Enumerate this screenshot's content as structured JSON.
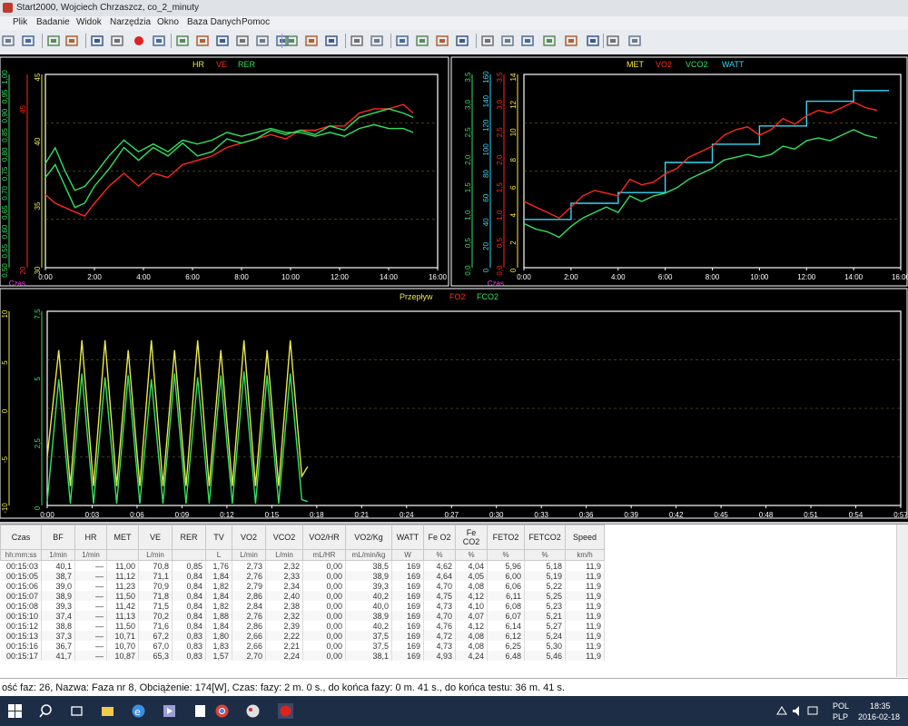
{
  "window": {
    "title": "Start2000,  Wojciech Chrzaszcz,  co_2_minuty"
  },
  "menu": [
    "Plik",
    "Badanie",
    "Widok",
    "Narzędzia",
    "Okno",
    "Baza Danych",
    "Pomoc"
  ],
  "toolbar_icons": [
    "open-icon",
    "save-icon",
    "print-icon",
    "preview-icon",
    "arrow-right-icon",
    "link-icon",
    "record-icon",
    "forward-icon",
    "pen-icon",
    "bar-icon",
    "arrow-into-icon",
    "export-icon",
    "select-icon",
    "check-icon",
    "tools-icon",
    "settings-icon",
    "cancel-icon",
    "flag-icon",
    "key-icon",
    "info-icon",
    "zoom-in-icon",
    "zoom-out-icon",
    "zoom-fit-icon",
    "zoom-reset-icon",
    "chart1-icon",
    "chart2-icon",
    "chart3-icon",
    "chart4-icon",
    "table-icon",
    "grid-icon",
    "co-icon"
  ],
  "colors": {
    "hr": "#e8e84a",
    "ve": "#ff2a1a",
    "rer": "#33e060",
    "met": "#ffe840",
    "vo2": "#ff2a1a",
    "vco2": "#33e060",
    "watt": "#35d8f5",
    "flow": "#e8e84a",
    "fo2": "#ff2a1a",
    "fco2": "#33e060",
    "axis_label": "#ff40ff",
    "frame": "#ffffff"
  },
  "chart_data": [
    {
      "type": "line",
      "legend": [
        "HR",
        "VE",
        "RER"
      ],
      "x_tick_labels": [
        "0:00",
        "2:00",
        "4:00",
        "6:00",
        "8:00",
        "10:00",
        "12:00",
        "14:00",
        "16:00"
      ],
      "x_axis_label": "Czas",
      "xlim": [
        0,
        16
      ],
      "y_axes": [
        {
          "name": "RER",
          "ticks": [
            "0,50",
            "0,55",
            "0,60",
            "0,65",
            "0,70",
            "0,75",
            "0,80",
            "0,85",
            "0,90",
            "0,95",
            "1,00"
          ]
        },
        {
          "name": "VE",
          "ticks": [
            "20",
            "",
            "",
            "",
            "",
            "45",
            ""
          ]
        },
        {
          "name": "HR",
          "ticks": [
            "30",
            "35",
            "40",
            "45"
          ]
        }
      ],
      "series": [
        {
          "name": "HR",
          "x": [
            0,
            0.4,
            0.8,
            1.2,
            1.6,
            2.0,
            2.6,
            3.2,
            3.8,
            4.4,
            5.0,
            5.6,
            6.2,
            6.8,
            7.4,
            8.0,
            8.6,
            9.2,
            9.8,
            10.4,
            11.0,
            11.6,
            12.2,
            12.8,
            13.4,
            14.0,
            14.6,
            15.0
          ],
          "values": [
            36,
            39,
            34,
            29,
            30,
            34,
            38,
            43,
            40,
            43,
            41,
            44,
            41,
            42,
            45,
            44,
            45,
            47,
            46,
            47,
            46,
            48,
            47,
            50,
            51,
            52,
            51,
            50
          ]
        },
        {
          "name": "VE",
          "x": [
            0,
            0.4,
            0.8,
            1.2,
            1.6,
            2.0,
            2.6,
            3.2,
            3.8,
            4.4,
            5.0,
            5.6,
            6.2,
            6.8,
            7.4,
            8.0,
            8.6,
            9.2,
            9.8,
            10.4,
            11.0,
            11.6,
            12.2,
            12.8,
            13.4,
            14.0,
            14.6,
            15.0
          ],
          "values": [
            32,
            30,
            29,
            28,
            27,
            30,
            34,
            37,
            34,
            37,
            36,
            39,
            40,
            41,
            43,
            44,
            45,
            46,
            45,
            47,
            47,
            48,
            48,
            51,
            52,
            52,
            53,
            51
          ]
        },
        {
          "name": "RER",
          "x": [
            0,
            0.4,
            0.8,
            1.2,
            1.6,
            2.0,
            2.6,
            3.2,
            3.8,
            4.4,
            5.0,
            5.6,
            6.2,
            6.8,
            7.4,
            8.0,
            8.6,
            9.2,
            9.8,
            10.4,
            11.0,
            11.6,
            12.2,
            12.8,
            13.4,
            14.0,
            14.6,
            15.0
          ],
          "values": [
            0.77,
            0.81,
            0.75,
            0.7,
            0.71,
            0.74,
            0.79,
            0.83,
            0.8,
            0.82,
            0.8,
            0.83,
            0.82,
            0.83,
            0.85,
            0.84,
            0.85,
            0.86,
            0.85,
            0.85,
            0.84,
            0.85,
            0.84,
            0.86,
            0.87,
            0.86,
            0.86,
            0.85
          ]
        }
      ]
    },
    {
      "type": "line",
      "legend": [
        "MET",
        "VO2",
        "VCO2",
        "WATT"
      ],
      "x_tick_labels": [
        "0:00",
        "2:00",
        "4:00",
        "6:00",
        "8:00",
        "10:00",
        "12:00",
        "14:00",
        "16:00"
      ],
      "x_axis_label": "Czas",
      "xlim": [
        0,
        16
      ],
      "y_axes": [
        {
          "name": "VCO2",
          "ticks": [
            "0,0",
            "0,5",
            "1,0",
            "1,5",
            "2,0",
            "2,5",
            "3,0",
            "3,5"
          ]
        },
        {
          "name": "WATT",
          "ticks": [
            "0",
            "20",
            "40",
            "60",
            "80",
            "100",
            "120",
            "140",
            "160"
          ]
        },
        {
          "name": "VO2",
          "ticks": [
            "0,0",
            "0,5",
            "1,0",
            "1,5",
            "2,0",
            "2,5",
            "3,0",
            "3,5"
          ]
        },
        {
          "name": "MET",
          "ticks": [
            "0",
            "2",
            "4",
            "6",
            "8",
            "10",
            "12",
            "14"
          ]
        }
      ],
      "series": [
        {
          "name": "WATT",
          "x": [
            0,
            2,
            2,
            4,
            4,
            6,
            6,
            8,
            8,
            10,
            10,
            12,
            12,
            14,
            14,
            15.5
          ],
          "values": [
            45,
            45,
            60,
            60,
            70,
            70,
            98,
            98,
            115,
            115,
            132,
            132,
            155,
            155,
            165,
            165
          ]
        },
        {
          "name": "VO2",
          "x": [
            0,
            0.5,
            1.0,
            1.5,
            2.0,
            2.5,
            3.0,
            3.5,
            4.0,
            4.5,
            5.0,
            5.5,
            6.0,
            6.5,
            7.0,
            7.5,
            8.0,
            8.5,
            9.0,
            9.5,
            10.0,
            10.5,
            11.0,
            11.5,
            12.0,
            12.5,
            13.0,
            13.5,
            14.0,
            14.5,
            15.0
          ],
          "values": [
            1.2,
            1.1,
            1.0,
            0.9,
            1.1,
            1.3,
            1.4,
            1.35,
            1.3,
            1.6,
            1.5,
            1.55,
            1.7,
            1.8,
            2.0,
            2.1,
            2.2,
            2.4,
            2.5,
            2.55,
            2.4,
            2.5,
            2.7,
            2.6,
            2.75,
            2.85,
            2.8,
            2.9,
            3.0,
            2.9,
            2.85
          ]
        },
        {
          "name": "VCO2",
          "x": [
            0,
            0.5,
            1.0,
            1.5,
            2.0,
            2.5,
            3.0,
            3.5,
            4.0,
            4.5,
            5.0,
            5.5,
            6.0,
            6.5,
            7.0,
            7.5,
            8.0,
            8.5,
            9.0,
            9.5,
            10.0,
            10.5,
            11.0,
            11.5,
            12.0,
            12.5,
            13.0,
            13.5,
            14.0,
            14.5,
            15.0
          ],
          "values": [
            0.8,
            0.7,
            0.65,
            0.55,
            0.75,
            0.9,
            1.0,
            1.1,
            1.0,
            1.3,
            1.2,
            1.3,
            1.35,
            1.45,
            1.6,
            1.7,
            1.8,
            1.95,
            2.0,
            2.05,
            2.0,
            2.05,
            2.2,
            2.15,
            2.3,
            2.35,
            2.3,
            2.4,
            2.5,
            2.4,
            2.35
          ]
        }
      ]
    },
    {
      "type": "line",
      "legend": [
        "Przepływ",
        "FO2",
        "FCO2"
      ],
      "x_tick_labels": [
        "0:00",
        "0:03",
        "0:06",
        "0:09",
        "0:12",
        "0:15",
        "0:18",
        "0:21",
        "0:24",
        "0:27",
        "0:30",
        "0:33",
        "0:36",
        "0:39",
        "0:42",
        "0:45",
        "0:48",
        "0:51",
        "0:54",
        "0:57"
      ],
      "xlim": [
        0,
        59
      ],
      "y_axes": [
        {
          "name": "Przepływ",
          "ticks": [
            "-10",
            "-5",
            "0",
            "5",
            "10"
          ]
        },
        {
          "name": "FCO2",
          "ticks": [
            "0",
            "2,5",
            "5",
            "7,5"
          ]
        }
      ],
      "series": [
        {
          "name": "Przepływ",
          "x": [
            0,
            0.8,
            1.6,
            2.4,
            3.2,
            4.0,
            4.8,
            5.6,
            6.4,
            7.2,
            8.0,
            8.8,
            9.6,
            10.4,
            11.2,
            12.0,
            12.8,
            13.6,
            14.4,
            15.2,
            16.0,
            16.8,
            17.6,
            18.0
          ],
          "values": [
            -5,
            6,
            -8,
            7,
            -8,
            7,
            -8,
            6,
            -8,
            7,
            -8,
            6,
            -8,
            7,
            -8,
            6,
            -8,
            7,
            -8,
            6,
            -8,
            7,
            -7,
            -6
          ]
        },
        {
          "name": "FCO2",
          "x": [
            0,
            0.8,
            1.6,
            2.4,
            3.2,
            4.0,
            4.8,
            5.6,
            6.4,
            7.2,
            8.0,
            8.8,
            9.6,
            10.4,
            11.2,
            12.0,
            12.8,
            13.6,
            14.4,
            15.2,
            16.0,
            16.8,
            17.6,
            18.0
          ],
          "values": [
            0.2,
            6.5,
            0.1,
            6.8,
            0.1,
            6.6,
            0.1,
            6.7,
            0.1,
            6.5,
            0.1,
            6.8,
            0.1,
            6.6,
            0.1,
            6.7,
            0.1,
            6.9,
            0.1,
            6.7,
            0.1,
            6.8,
            0.3,
            0.2
          ]
        }
      ]
    }
  ],
  "table": {
    "headers": [
      "Czas",
      "BF",
      "HR",
      "MET",
      "VE",
      "RER",
      "TV",
      "VO2",
      "VCO2",
      "VO2/HR",
      "VO2/Kg",
      "WATT",
      "Fe O2",
      "Fe CO2",
      "FETO2",
      "FETCO2",
      "Speed"
    ],
    "units": [
      "hh:mm:ss",
      "1/min",
      "1/min",
      "",
      "L/min",
      "",
      "L",
      "L/min",
      "L/min",
      "mL/HR",
      "mL/min/kg",
      "W",
      "%",
      "%",
      "%",
      "%",
      "km/h"
    ],
    "rows": [
      [
        "00:15:03",
        "40,1",
        "—",
        "11,00",
        "70,8",
        "0,85",
        "1,76",
        "2,73",
        "2,32",
        "0,00",
        "38,5",
        "169",
        "4,62",
        "4,04",
        "5,96",
        "5,18",
        "11,9"
      ],
      [
        "00:15:05",
        "38,7",
        "—",
        "11,12",
        "71,1",
        "0,84",
        "1,84",
        "2,76",
        "2,33",
        "0,00",
        "38,9",
        "169",
        "4,64",
        "4,05",
        "6,00",
        "5,19",
        "11,9"
      ],
      [
        "00:15:06",
        "39,0",
        "—",
        "11,23",
        "70,9",
        "0,84",
        "1,82",
        "2,79",
        "2,34",
        "0,00",
        "39,3",
        "169",
        "4,70",
        "4,08",
        "6,06",
        "5,22",
        "11,9"
      ],
      [
        "00:15:07",
        "38,9",
        "—",
        "11,50",
        "71,8",
        "0,84",
        "1,84",
        "2,86",
        "2,40",
        "0,00",
        "40,2",
        "169",
        "4,75",
        "4,12",
        "6,11",
        "5,25",
        "11,9"
      ],
      [
        "00:15:08",
        "39,3",
        "—",
        "11,42",
        "71,5",
        "0,84",
        "1,82",
        "2,84",
        "2,38",
        "0,00",
        "40,0",
        "169",
        "4,73",
        "4,10",
        "6,08",
        "5,23",
        "11,9"
      ],
      [
        "00:15:10",
        "37,4",
        "—",
        "11,13",
        "70,2",
        "0,84",
        "1,88",
        "2,76",
        "2,32",
        "0,00",
        "38,9",
        "169",
        "4,70",
        "4,07",
        "6,07",
        "5,21",
        "11,9"
      ],
      [
        "00:15:12",
        "38,8",
        "—",
        "11,50",
        "71,6",
        "0,84",
        "1,84",
        "2,86",
        "2,39",
        "0,00",
        "40,2",
        "169",
        "4,76",
        "4,12",
        "6,14",
        "5,27",
        "11,9"
      ],
      [
        "00:15:13",
        "37,3",
        "—",
        "10,71",
        "67,2",
        "0,83",
        "1,80",
        "2,66",
        "2,22",
        "0,00",
        "37,5",
        "169",
        "4,72",
        "4,08",
        "6,12",
        "5,24",
        "11,9"
      ],
      [
        "00:15:16",
        "36,7",
        "—",
        "10,70",
        "67,0",
        "0,83",
        "1,83",
        "2,66",
        "2,21",
        "0,00",
        "37,5",
        "169",
        "4,73",
        "4,08",
        "6,25",
        "5,30",
        "11,9"
      ],
      [
        "00:15:17",
        "41,7",
        "—",
        "10,87",
        "65,3",
        "0,83",
        "1,57",
        "2,70",
        "2,24",
        "0,00",
        "38,1",
        "169",
        "4,93",
        "4,24",
        "6,48",
        "5,46",
        "11,9"
      ]
    ]
  },
  "status": "ość faz: 26, Nazwa: Faza nr 8, Obciążenie: 174[W], Czas: fazy: 2 m. 0 s., do końca fazy: 0 m. 41 s., do końca testu: 36 m. 41 s.",
  "taskbar": {
    "lang1": "POL",
    "lang2": "PLP",
    "time": "18:35",
    "date": "2016-02-18"
  }
}
